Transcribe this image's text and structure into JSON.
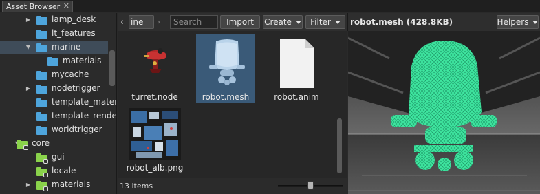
{
  "tab": {
    "title": "Asset Browser",
    "close_glyph": "✕"
  },
  "tree": {
    "items": [
      {
        "label": "lamp_desk",
        "depth": 1,
        "expander": "collapsed",
        "icon": "folder-icon",
        "color": "#4ea5dc",
        "selected": false
      },
      {
        "label": "lt_features",
        "depth": 1,
        "expander": "none",
        "icon": "folder-icon",
        "color": "#4ea5dc",
        "selected": false
      },
      {
        "label": "marine",
        "depth": 1,
        "expander": "expanded",
        "icon": "folder-icon",
        "color": "#4ea5dc",
        "selected": true
      },
      {
        "label": "materials",
        "depth": 2,
        "expander": "none",
        "icon": "folder-icon",
        "color": "#4ea5dc",
        "selected": false
      },
      {
        "label": "mycache",
        "depth": 1,
        "expander": "none",
        "icon": "folder-icon",
        "color": "#4ea5dc",
        "selected": false
      },
      {
        "label": "nodetrigger",
        "depth": 1,
        "expander": "collapsed",
        "icon": "folder-icon",
        "color": "#4ea5dc",
        "selected": false
      },
      {
        "label": "template_mater...",
        "depth": 1,
        "expander": "none",
        "icon": "folder-icon",
        "color": "#4ea5dc",
        "selected": false
      },
      {
        "label": "template_rende...",
        "depth": 1,
        "expander": "none",
        "icon": "folder-icon",
        "color": "#4ea5dc",
        "selected": false
      },
      {
        "label": "worldtrigger",
        "depth": 1,
        "expander": "none",
        "icon": "folder-icon",
        "color": "#4ea5dc",
        "selected": false
      },
      {
        "label": "core",
        "depth": 0,
        "expander": "expanded",
        "icon": "locked-folder-icon",
        "color": "#8ad24b",
        "selected": false
      },
      {
        "label": "gui",
        "depth": 1,
        "expander": "none",
        "icon": "locked-folder-icon",
        "color": "#8ad24b",
        "selected": false
      },
      {
        "label": "locale",
        "depth": 1,
        "expander": "none",
        "icon": "locked-folder-icon",
        "color": "#8ad24b",
        "selected": false
      },
      {
        "label": "materials",
        "depth": 1,
        "expander": "collapsed",
        "icon": "locked-folder-icon",
        "color": "#8ad24b",
        "selected": false
      }
    ]
  },
  "toolbar": {
    "path_crumb": "ine",
    "search_placeholder": "Search",
    "import_label": "Import",
    "create_label": "Create",
    "filter_label": "Filter"
  },
  "files": [
    {
      "name": "turret.node",
      "kind": "node",
      "selected": false
    },
    {
      "name": "robot.mesh",
      "kind": "mesh",
      "selected": true
    },
    {
      "name": "robot.anim",
      "kind": "anim",
      "selected": false
    },
    {
      "name": "robot_alb.png",
      "kind": "texture",
      "selected": false
    }
  ],
  "status": {
    "item_count": "13 items",
    "thumb_size_fraction": 0.5
  },
  "preview": {
    "title": "robot.mesh (428.8KB)",
    "helpers_label": "Helpers",
    "wire_color": "#3fe6a0"
  }
}
